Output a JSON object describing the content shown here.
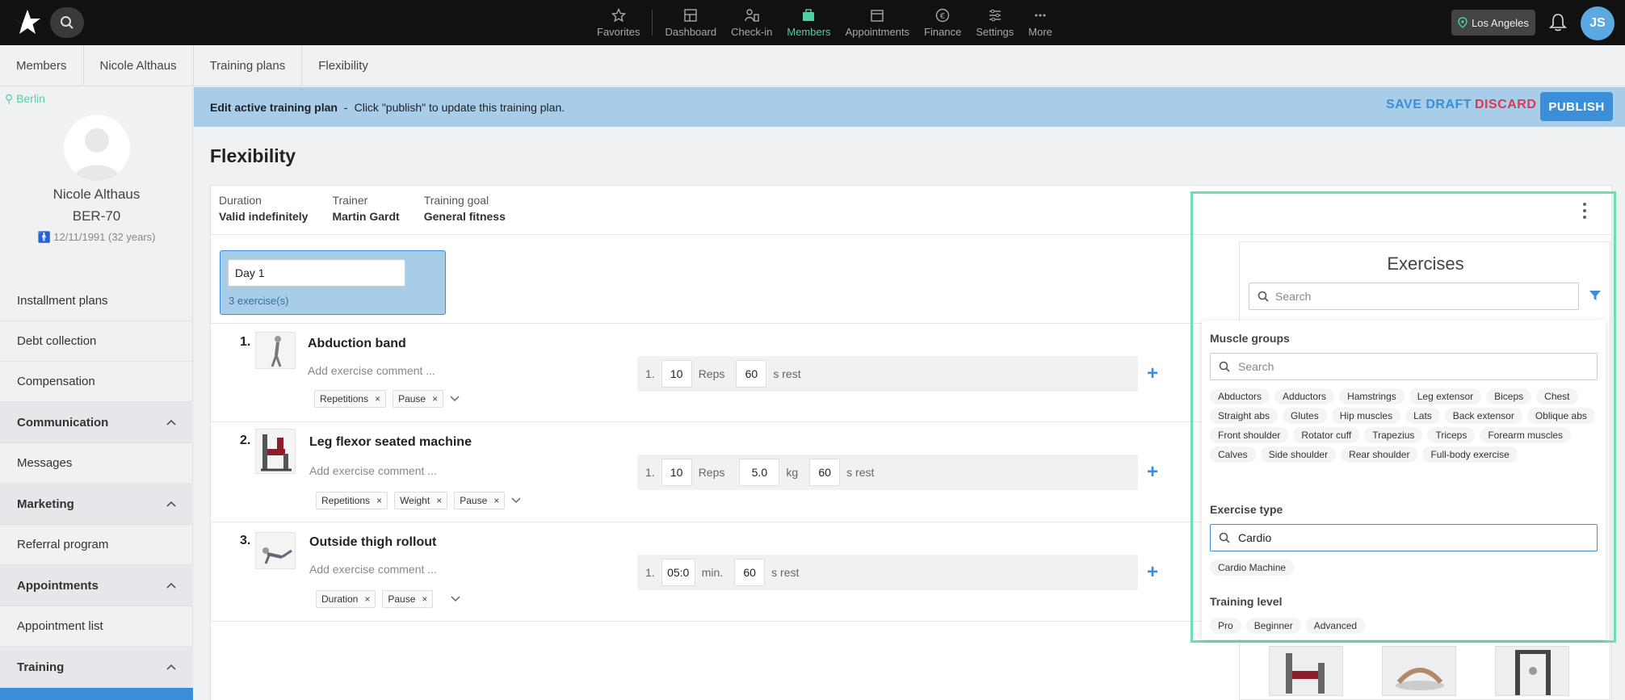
{
  "nav": {
    "items": [
      {
        "label": "Favorites",
        "icon": "star-icon"
      },
      {
        "label": "Dashboard",
        "icon": "dashboard-icon"
      },
      {
        "label": "Check-in",
        "icon": "checkin-icon"
      },
      {
        "label": "Members",
        "icon": "members-icon",
        "active": true
      },
      {
        "label": "Appointments",
        "icon": "calendar-icon"
      },
      {
        "label": "Finance",
        "icon": "euro-icon"
      },
      {
        "label": "Settings",
        "icon": "sliders-icon"
      },
      {
        "label": "More",
        "icon": "more-icon"
      }
    ],
    "location": "Los Angeles",
    "user_initials": "JS"
  },
  "breadcrumb": [
    "Members",
    "Nicole Althaus",
    "Training plans",
    "Flexibility"
  ],
  "sidebar": {
    "location_tag": "Berlin",
    "name": "Nicole Althaus",
    "member_id": "BER-70",
    "dob": "12/11/1991 (32 years)",
    "items_top": [
      "Installment plans",
      "Debt collection",
      "Compensation"
    ],
    "sections": [
      {
        "title": "Communication",
        "items": [
          "Messages"
        ]
      },
      {
        "title": "Marketing",
        "items": [
          "Referral program"
        ]
      },
      {
        "title": "Appointments",
        "items": [
          "Appointment list"
        ]
      },
      {
        "title": "Training",
        "items": []
      }
    ]
  },
  "banner": {
    "title": "Edit active training plan",
    "separator": "-",
    "message": "Click \"publish\" to update this training plan.",
    "save_draft": "SAVE DRAFT",
    "discard": "DISCARD",
    "publish": "PUBLISH"
  },
  "plan": {
    "title": "Flexibility",
    "meta": [
      {
        "label": "Duration",
        "value": "Valid indefinitely"
      },
      {
        "label": "Trainer",
        "value": "Martin Gardt"
      },
      {
        "label": "Training goal",
        "value": "General fitness"
      }
    ],
    "day": {
      "name": "Day 1",
      "count": "3 exercise(s)"
    },
    "comment_placeholder": "Add exercise comment ...",
    "exercises": [
      {
        "num": "1.",
        "name": "Abduction band",
        "tags": [
          "Repetitions",
          "Pause"
        ],
        "set_num": "1.",
        "reps": "10",
        "reps_unit": "Reps",
        "rest": "60",
        "rest_unit": "s rest"
      },
      {
        "num": "2.",
        "name": "Leg flexor seated machine",
        "tags": [
          "Repetitions",
          "Weight",
          "Pause"
        ],
        "set_num": "1.",
        "reps": "10",
        "reps_unit": "Reps",
        "weight": "5.0",
        "weight_unit": "kg",
        "rest": "60",
        "rest_unit": "s rest"
      },
      {
        "num": "3.",
        "name": "Outside thigh rollout",
        "tags": [
          "Duration",
          "Pause"
        ],
        "set_num": "1.",
        "duration": "05:0",
        "duration_unit": "min.",
        "rest": "60",
        "rest_unit": "s rest"
      }
    ]
  },
  "exercises_panel": {
    "title": "Exercises",
    "search_placeholder": "Search",
    "filter": {
      "muscle_groups_label": "Muscle groups",
      "muscle_search_placeholder": "Search",
      "muscle_groups": [
        "Abductors",
        "Adductors",
        "Hamstrings",
        "Leg extensor",
        "Biceps",
        "Chest",
        "Straight abs",
        "Glutes",
        "Hip muscles",
        "Lats",
        "Back extensor",
        "Oblique abs",
        "Front shoulder",
        "Rotator cuff",
        "Trapezius",
        "Triceps",
        "Forearm muscles",
        "Calves",
        "Side shoulder",
        "Rear shoulder",
        "Full-body exercise"
      ],
      "exercise_type_label": "Exercise type",
      "exercise_type_query": "Cardio",
      "exercise_types": [
        "Cardio Machine"
      ],
      "training_level_label": "Training level",
      "training_levels": [
        "Pro",
        "Beginner",
        "Advanced"
      ]
    }
  }
}
